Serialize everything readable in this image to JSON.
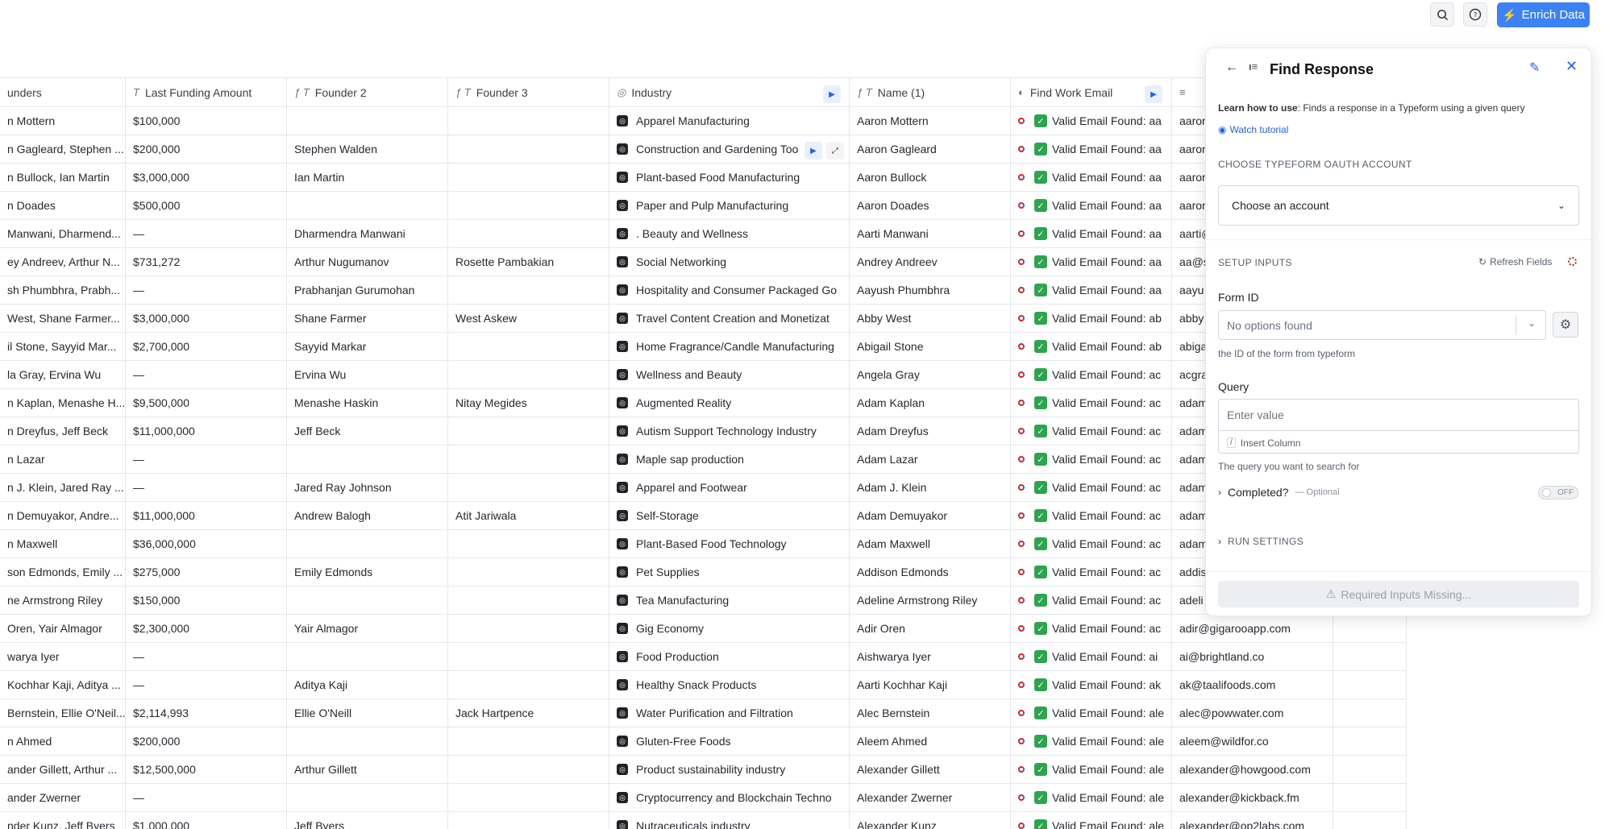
{
  "toolbar": {
    "search_icon": "search-icon",
    "help_icon": "help-icon",
    "enrich_label": "Enrich Data",
    "enrich_color": "#3b82f6"
  },
  "columns": [
    {
      "label": "unders",
      "icon": "",
      "width": 156
    },
    {
      "label": "Last Funding Amount",
      "icon": "T",
      "width": 200
    },
    {
      "label": "Founder 2",
      "icon": "ƒ T",
      "width": 200
    },
    {
      "label": "Founder 3",
      "icon": "ƒ T",
      "width": 200
    },
    {
      "label": "Industry",
      "icon": "◎",
      "width": 298
    },
    {
      "label": "Name (1)",
      "icon": "ƒ T",
      "width": 200
    },
    {
      "label": "Find Work Email",
      "icon": "◐",
      "width": 200
    },
    {
      "label": "",
      "icon": "≡",
      "width": 200
    },
    {
      "label": "",
      "icon": "",
      "width": 91
    }
  ],
  "rows": [
    [
      "n Mottern",
      "$100,000",
      "",
      "",
      "Apparel Manufacturing",
      "Aaron Mottern",
      "Valid Email Found: aa",
      "aaron",
      ""
    ],
    [
      "n Gagleard, Stephen ...",
      "$200,000",
      "Stephen Walden",
      "",
      "Construction and Gardening Too",
      "Aaron Gagleard",
      "Valid Email Found: aa",
      "aaron",
      ""
    ],
    [
      "n Bullock, Ian Martin",
      "$3,000,000",
      "Ian Martin",
      "",
      "Plant-based Food Manufacturing",
      "Aaron Bullock",
      "Valid Email Found: aa",
      "aaron",
      ""
    ],
    [
      "n Doades",
      "$500,000",
      "",
      "",
      "Paper and Pulp Manufacturing",
      "Aaron Doades",
      "Valid Email Found: aa",
      "aaron",
      ""
    ],
    [
      "Manwani, Dharmend...",
      "—",
      "Dharmendra Manwani",
      "",
      ". Beauty and Wellness",
      "Aarti Manwani",
      "Valid Email Found: aa",
      "aarti@",
      ""
    ],
    [
      "ey Andreev, Arthur N...",
      "$731,272",
      "Arthur Nugumanov",
      "Rosette Pambakian",
      "Social Networking",
      "Andrey Andreev",
      "Valid Email Found: aa",
      "aa@s",
      ""
    ],
    [
      "sh Phumbhra, Prabh...",
      "—",
      "Prabhanjan Gurumohan",
      "",
      "Hospitality and Consumer Packaged Go",
      "Aayush Phumbhra",
      "Valid Email Found: aa",
      "aayu",
      ""
    ],
    [
      " West, Shane Farmer...",
      "$3,000,000",
      "Shane Farmer",
      "West Askew",
      "Travel Content Creation and Monetizat",
      "Abby West",
      "Valid Email Found: ab",
      "abby",
      ""
    ],
    [
      "il Stone, Sayyid Mar...",
      "$2,700,000",
      "Sayyid Markar",
      "",
      "Home Fragrance/Candle Manufacturing",
      "Abigail Stone",
      "Valid Email Found: ab",
      "abiga",
      ""
    ],
    [
      "la Gray, Ervina Wu",
      "—",
      "Ervina Wu",
      "",
      "Wellness and Beauty",
      "Angela Gray",
      "Valid Email Found: ac",
      "acgra",
      ""
    ],
    [
      "n Kaplan, Menashe H...",
      "$9,500,000",
      "Menashe Haskin",
      "Nitay Megides",
      "Augmented Reality",
      "Adam Kaplan",
      "Valid Email Found: ac",
      "adam",
      ""
    ],
    [
      "n Dreyfus, Jeff Beck",
      "$11,000,000",
      "Jeff Beck",
      "",
      "Autism Support Technology Industry",
      "Adam Dreyfus",
      "Valid Email Found: ac",
      "adam",
      ""
    ],
    [
      "n Lazar",
      "—",
      "",
      "",
      "Maple sap production",
      "Adam Lazar",
      "Valid Email Found: ac",
      "adam",
      ""
    ],
    [
      "n J. Klein, Jared Ray ...",
      "—",
      "Jared Ray Johnson",
      "",
      "Apparel and Footwear",
      "Adam J. Klein",
      "Valid Email Found: ac",
      "adam",
      ""
    ],
    [
      "n Demuyakor, Andre...",
      "$11,000,000",
      "Andrew Balogh",
      "Atit Jariwala",
      "Self-Storage",
      "Adam Demuyakor",
      "Valid Email Found: ac",
      "adam",
      ""
    ],
    [
      "n Maxwell",
      "$36,000,000",
      "",
      "",
      "Plant-Based Food Technology",
      "Adam Maxwell",
      "Valid Email Found: ac",
      "adam",
      ""
    ],
    [
      "son Edmonds, Emily ...",
      "$275,000",
      "Emily Edmonds",
      "",
      "Pet Supplies",
      "Addison Edmonds",
      "Valid Email Found: ac",
      "addis",
      ""
    ],
    [
      "ne Armstrong Riley",
      "$150,000",
      "",
      "",
      "Tea Manufacturing",
      "Adeline Armstrong Riley",
      "Valid Email Found: ac",
      "adeli",
      ""
    ],
    [
      "Oren, Yair Almagor",
      "$2,300,000",
      "Yair Almagor",
      "",
      "Gig Economy",
      "Adir Oren",
      "Valid Email Found: ac",
      "adir@gigarooapp.com",
      ""
    ],
    [
      "warya Iyer",
      "—",
      "",
      "",
      "Food Production",
      "Aishwarya Iyer",
      "Valid Email Found: ai",
      "ai@brightland.co",
      ""
    ],
    [
      "Kochhar Kaji, Aditya ...",
      "—",
      "Aditya Kaji",
      "",
      "Healthy Snack Products",
      "Aarti Kochhar Kaji",
      "Valid Email Found: ak",
      "ak@taalifoods.com",
      ""
    ],
    [
      "Bernstein, Ellie O'Neil...",
      "$2,114,993",
      "Ellie O'Neill",
      "Jack Hartpence",
      "Water Purification and Filtration",
      "Alec Bernstein",
      "Valid Email Found: ale",
      "alec@powwater.com",
      ""
    ],
    [
      "n Ahmed",
      "$200,000",
      "",
      "",
      "Gluten-Free Foods",
      "Aleem Ahmed",
      "Valid Email Found: ale",
      "aleem@wildfor.co",
      ""
    ],
    [
      "ander Gillett, Arthur ...",
      "$12,500,000",
      "Arthur Gillett",
      "",
      "Product sustainability industry",
      "Alexander Gillett",
      "Valid Email Found: ale",
      "alexander@howgood.com",
      ""
    ],
    [
      "ander Zwerner",
      "—",
      "",
      "",
      "Cryptocurrency and Blockchain Techno",
      "Alexander Zwerner",
      "Valid Email Found: ale",
      "alexander@kickback.fm",
      ""
    ],
    [
      "nder Kunz, Jeff Byers",
      "$1,000,000",
      "Jeff Byers",
      "",
      "Nutraceuticals industry",
      "Alexander Kunz",
      "Valid Email Found: ale",
      "alexander@op2labs.com",
      ""
    ]
  ],
  "panel": {
    "title": "Find Response",
    "learn_prefix": "Learn how to use",
    "learn_text": ": Finds a response in a Typeform using a given query",
    "watch_tutorial": "Watch tutorial",
    "oauth_section": "CHOOSE TYPEFORM OAUTH ACCOUNT",
    "account_select": "Choose an account",
    "setup_section": "SETUP INPUTS",
    "refresh_fields": "Refresh Fields",
    "form_id_label": "Form ID",
    "form_id_value": "No options found",
    "form_id_help": "the ID of the form from typeform",
    "query_label": "Query",
    "query_placeholder": "Enter value",
    "insert_column": "Insert Column",
    "query_help": "The query you want to search for",
    "completed_label": "Completed?",
    "completed_optional": "— Optional",
    "toggle_label": "OFF",
    "run_settings": "RUN SETTINGS",
    "required_missing": "Required Inputs Missing..."
  }
}
